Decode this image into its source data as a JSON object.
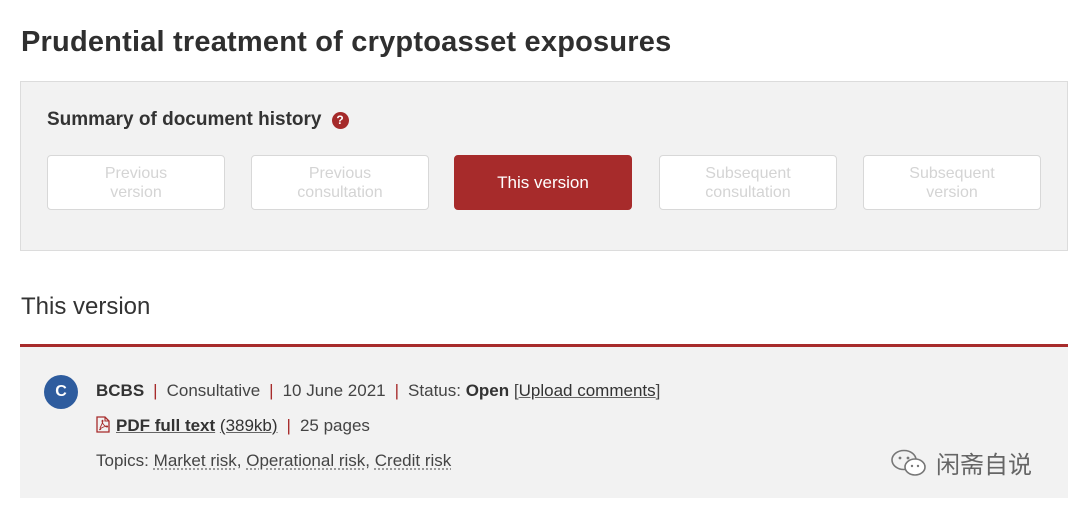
{
  "page": {
    "title": "Prudential treatment of cryptoasset exposures"
  },
  "history": {
    "title": "Summary of document history",
    "help_icon": "question-circle-icon",
    "versions": [
      {
        "label": "Previous\nversion",
        "active": false
      },
      {
        "label": "Previous\nconsultation",
        "active": false
      },
      {
        "label": "This version",
        "active": true
      },
      {
        "label": "Subsequent\nconsultation",
        "active": false
      },
      {
        "label": "Subsequent\nversion",
        "active": false
      }
    ]
  },
  "section": {
    "title": "This version"
  },
  "document": {
    "badge": "C",
    "publisher": "BCBS",
    "type": "Consultative",
    "date": "10 June 2021",
    "status_label": "Status:",
    "status_value": "Open",
    "upload_comments": "Upload comments",
    "pdf_link": "PDF full text",
    "pdf_size": "(389kb)",
    "pages": "25 pages",
    "topics_label": "Topics:",
    "topics": [
      "Market risk",
      "Operational risk",
      "Credit risk"
    ]
  },
  "watermark": {
    "text": "闲斋自说",
    "icon": "wechat-icon"
  },
  "colors": {
    "accent": "#a72b2b",
    "badge": "#2e5c9e",
    "panel": "#f2f2f2"
  }
}
